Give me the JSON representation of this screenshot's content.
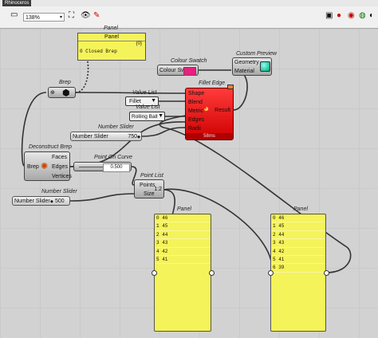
{
  "window": {
    "tab": "Rhinoceros"
  },
  "toolbar": {
    "zoom": "138%"
  },
  "panel_top": {
    "title": "Panel",
    "index": "{0}",
    "value": "0 Closed Brep"
  },
  "brep": {
    "title": "Brep"
  },
  "colour_swatch": {
    "title": "Colour Swatch",
    "label": "Colour Swatch",
    "color": "#e8207e"
  },
  "custom_preview": {
    "title": "Custom Preview",
    "inputs": [
      "Geometry",
      "Material"
    ]
  },
  "value_list_1": {
    "title": "Value List",
    "value": "Fillet"
  },
  "value_list_2": {
    "title": "Value List",
    "value": "Rolling Ball"
  },
  "fillet_edge": {
    "title": "Fillet Edge",
    "inputs": [
      "Shape",
      "Blend",
      "Metric",
      "Edges",
      "Radii"
    ],
    "output": "Result",
    "footer": "58ms"
  },
  "number_slider_1": {
    "title": "Number Slider",
    "label": "Number Slider",
    "value": "750"
  },
  "deconstruct_brep": {
    "title": "Deconstruct Brep",
    "input": "Brep",
    "outputs": [
      "Faces",
      "Edges",
      "Vertices"
    ]
  },
  "point_on_curve": {
    "title": "Point On Curve",
    "value": "0.500"
  },
  "point_list": {
    "title": "Point List",
    "inputs": [
      "Points",
      "Size"
    ]
  },
  "number_slider_2": {
    "title": "Number Slider",
    "label": "Number Slider",
    "value": "500"
  },
  "panel_bottom_1": {
    "title": "Panel",
    "rows": [
      "0 46",
      "1 45",
      "2 44",
      "3 43",
      "4 42",
      "5 41"
    ]
  },
  "panel_bottom_2": {
    "title": "Panel",
    "rows": [
      "0 46",
      "1 45",
      "2 44",
      "3 43",
      "4 42",
      "5 41",
      "6 39"
    ]
  }
}
